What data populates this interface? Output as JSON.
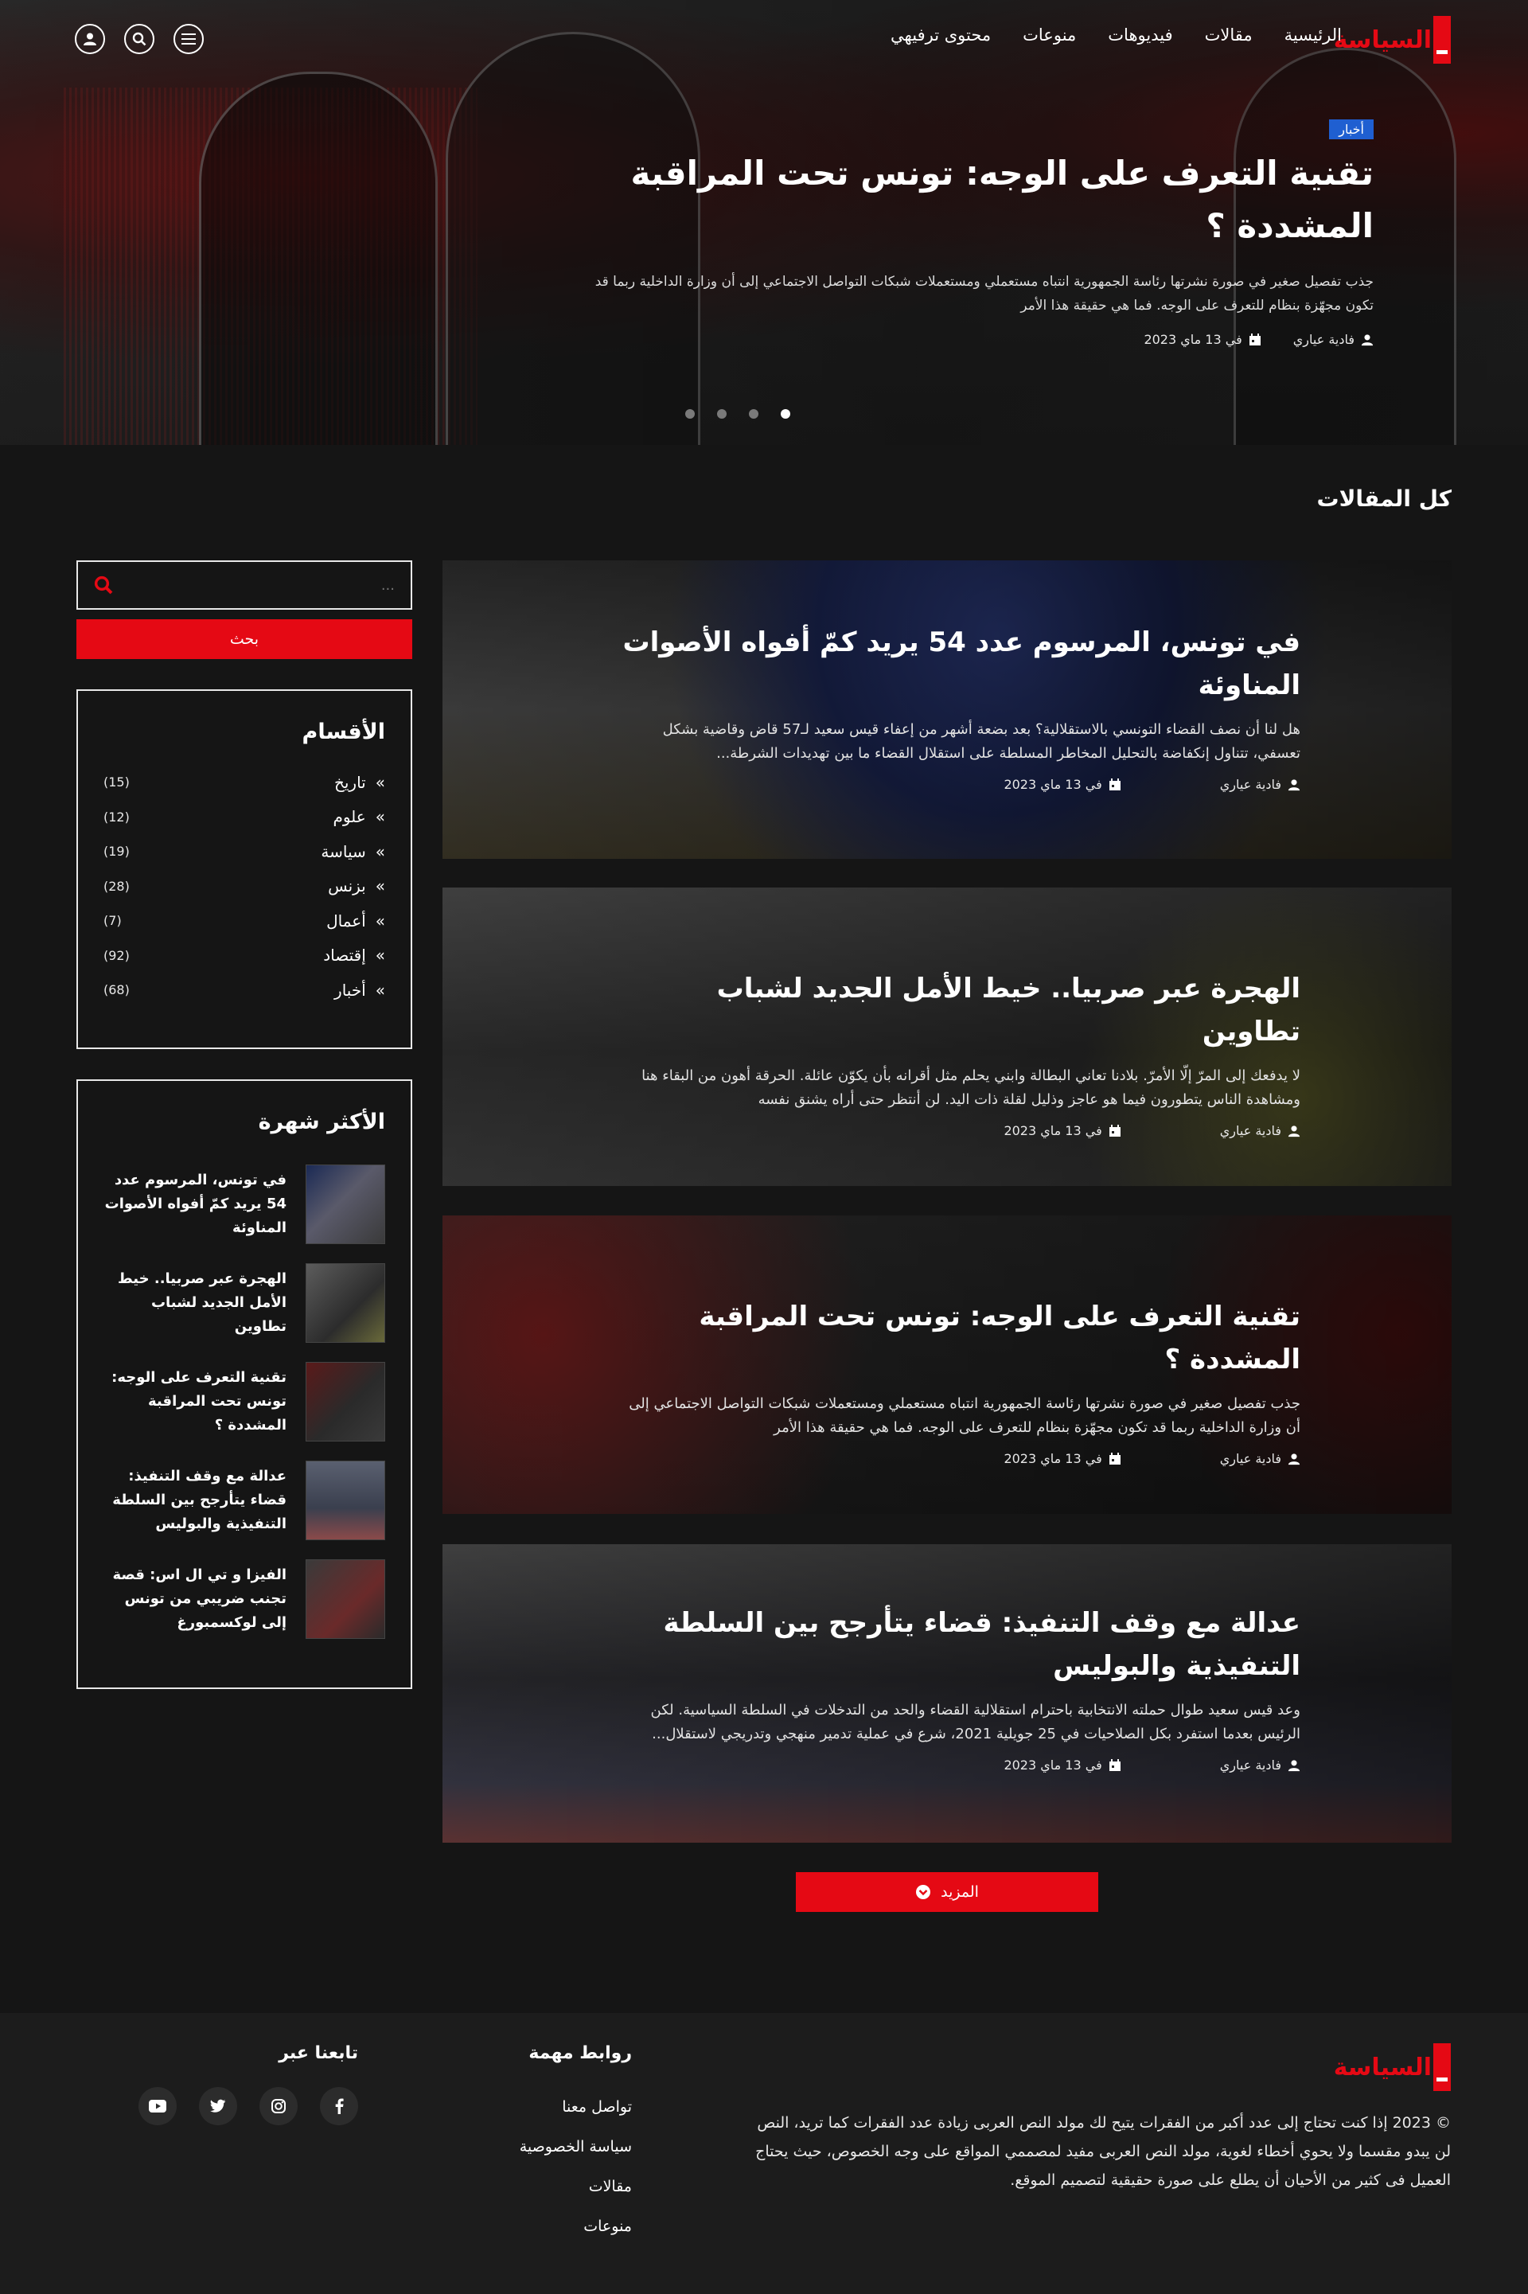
{
  "brand": {
    "logo_text": "السياسة"
  },
  "nav": {
    "items": [
      "الرئيسية",
      "مقالات",
      "فيديوهات",
      "منوعات",
      "محتوى ترفيهي"
    ]
  },
  "hero": {
    "badge": "أخبار",
    "title": "تقنية التعرف على الوجه: تونس تحت المراقبة المشددة ؟",
    "excerpt": "جذب تفصيل صغير في صورة نشرتها رئاسة الجمهورية انتباه مستعملي ومستعملات شبكات التواصل الاجتماعي إلى أن وزارة الداخلية ربما قد تكون مجهّزة بنظام للتعرف على الوجه. فما هي حقيقة هذا الأمر",
    "author": "فادية عياري",
    "date": "في 13 ماي 2023",
    "slides": 4,
    "active_slide": 4
  },
  "section": {
    "title": "كل المقالات"
  },
  "search": {
    "placeholder": "...",
    "button": "بحث"
  },
  "categories": {
    "title": "الأقسام",
    "items": [
      {
        "name": "تاريخ",
        "count": "(15)"
      },
      {
        "name": "علوم",
        "count": "(12)"
      },
      {
        "name": "سياسة",
        "count": "(19)"
      },
      {
        "name": "بزنس",
        "count": "(28)"
      },
      {
        "name": "أعمال",
        "count": "(7)"
      },
      {
        "name": "إقتصاد",
        "count": "(92)"
      },
      {
        "name": "أخبار",
        "count": "(68)"
      }
    ]
  },
  "popular": {
    "title": "الأكثر شهرة",
    "items": [
      "في تونس، المرسوم عدد 54 يريد كمّ أفواه الأصوات المناوئة",
      "الهجرة عبر صربيا.. خيط الأمل الجديد لشباب تطاوين",
      "تقنية التعرف على الوجه: تونس تحت المراقبة المشددة ؟",
      "عدالة مع وقف التنفيذ: قضاء يتأرجح بين السلطة التنفيذية والبوليس",
      "الفيزا و تي ال اس: قصة تجنب ضريبي من تونس إلى لوكسمبورغ"
    ]
  },
  "articles": [
    {
      "title": "في تونس، المرسوم عدد 54 يريد كمّ أفواه الأصوات المناوئة",
      "excerpt": "هل لنا أن نصف القضاء التونسي بالاستقلالية؟ بعد بضعة أشهر من إعفاء قيس سعيد لـ57 قاض وقاضية بشكل تعسفي، تتناول إنكفاضة بالتحليل المخاطر المسلطة على استقلال القضاء ما بين تهديدات الشرطة...",
      "author": "فادية عياري",
      "date": "في 13 ماي 2023"
    },
    {
      "title": "الهجرة عبر صربيا.. خيط الأمل الجديد لشباب تطاوين",
      "excerpt": "لا يدفعك إلى المرّ إلّا الأمرّ. بلادنا تعاني البطالة وابني يحلم مثل أقرانه بأن يكوّن عائلة. الحرقة أهون من البقاء هنا ومشاهدة الناس يتطورون فيما هو عاجز وذليل لقلة ذات اليد. لن أنتظر حتى أراه يشنق نفسه",
      "author": "فادية عياري",
      "date": "في 13 ماي 2023"
    },
    {
      "title": "تقنية التعرف على الوجه: تونس تحت المراقبة المشددة ؟",
      "excerpt": "جذب تفصيل صغير في صورة نشرتها رئاسة الجمهورية انتباه مستعملي ومستعملات شبكات التواصل الاجتماعي إلى أن وزارة الداخلية ربما قد تكون مجهّزة بنظام للتعرف على الوجه. فما هي حقيقة هذا الأمر",
      "author": "فادية عياري",
      "date": "في 13 ماي 2023"
    },
    {
      "title": "عدالة مع وقف التنفيذ: قضاء يتأرجح بين السلطة التنفيذية والبوليس",
      "excerpt": "وعد قيس سعيد طوال حملته الانتخابية باحترام استقلالية القضاء والحد من التدخلات في السلطة السياسية. لكن الرئيس بعدما استفرد بكل الصلاحيات في 25 جويلية 2021، شرع في عملية تدمير منهجي وتدريجي لاستقلال...",
      "author": "فادية عياري",
      "date": "في 13 ماي 2023"
    }
  ],
  "more_button": "المزيد",
  "footer": {
    "about": "© 2023 إذا كنت تحتاج إلى عدد أكبر من الفقرات يتيح لك مولد النص العربى زيادة عدد الفقرات كما تريد، النص لن يبدو مقسما ولا يحوي أخطاء لغوية، مولد النص العربى مفيد لمصممي المواقع على وجه الخصوص، حيث يحتاج العميل فى كثير من الأحيان أن يطلع على صورة حقيقية لتصميم الموقع.",
    "links_title": "روابط مهمة",
    "links": [
      "تواصل معنا",
      "سياسة الخصوصية",
      "مقالات",
      "منوعات"
    ],
    "follow_title": "تابعنا عبر",
    "socials": [
      "facebook-icon",
      "instagram-icon",
      "twitter-icon",
      "youtube-icon"
    ]
  }
}
